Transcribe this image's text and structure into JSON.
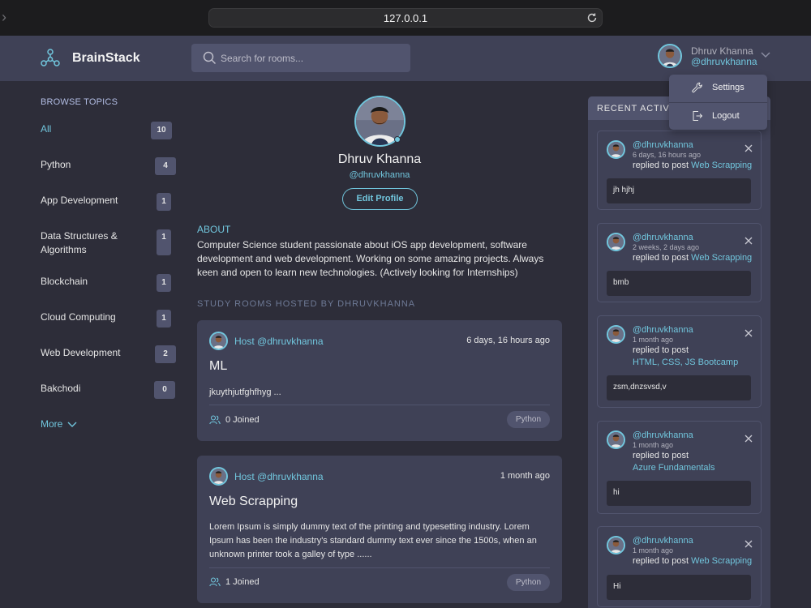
{
  "browser": {
    "url": "127.0.0.1"
  },
  "header": {
    "brand": "BrainStack",
    "search_placeholder": "Search for rooms...",
    "user_name": "Dhruv Khanna",
    "user_handle": "@dhruvkhanna"
  },
  "menu": {
    "settings": "Settings",
    "logout": "Logout"
  },
  "sidebar": {
    "title": "BROWSE TOPICS",
    "topics": [
      {
        "label": "All",
        "count": "10"
      },
      {
        "label": "Python",
        "count": "4"
      },
      {
        "label": "App Development",
        "count": "1"
      },
      {
        "label": "Data Structures & Algorithms",
        "count": "1"
      },
      {
        "label": "Blockchain",
        "count": "1"
      },
      {
        "label": "Cloud Computing",
        "count": "1"
      },
      {
        "label": "Web Development",
        "count": "2"
      },
      {
        "label": "Bakchodi",
        "count": "0"
      }
    ],
    "more": "More"
  },
  "profile": {
    "name": "Dhruv Khanna",
    "handle": "@dhruvkhanna",
    "edit_label": "Edit Profile",
    "about_title": "ABOUT",
    "about_text": "Computer Science student passionate about iOS app development, software development and web development. Working on some amazing projects. Always keen and open to learn new technologies. (Actively looking for Internships)",
    "rooms_title": "STUDY ROOMS HOSTED BY DHRUVKHANNA"
  },
  "rooms": [
    {
      "host": "Host @dhruvkhanna",
      "time": "6 days, 16 hours ago",
      "title": "ML",
      "description": "jkuythjutfghfhyg ...",
      "joined": "0 Joined",
      "topic": "Python"
    },
    {
      "host": "Host @dhruvkhanna",
      "time": "1 month ago",
      "title": "Web Scrapping",
      "description": "Lorem Ipsum is simply dummy text of the printing and typesetting industry. Lorem Ipsum has been the industry's standard dummy text ever since the 1500s, when an unknown printer took a galley of type ......",
      "joined": "1 Joined",
      "topic": "Python"
    }
  ],
  "recent": {
    "title": "RECENT ACTIVITIES",
    "items": [
      {
        "handle": "@dhruvkhanna",
        "time": "6 days, 16 hours ago",
        "action": "replied to post",
        "post": "Web Scrapping",
        "message": "jh hjhj"
      },
      {
        "handle": "@dhruvkhanna",
        "time": "2 weeks, 2 days ago",
        "action": "replied to post",
        "post": "Web Scrapping",
        "message": "bmb"
      },
      {
        "handle": "@dhruvkhanna",
        "time": "1 month ago",
        "action": "replied to post",
        "post": "HTML, CSS, JS Bootcamp",
        "message": "zsm,dnzsvsd,v"
      },
      {
        "handle": "@dhruvkhanna",
        "time": "1 month ago",
        "action": "replied to post",
        "post": "Azure Fundamentals",
        "message": "hi"
      },
      {
        "handle": "@dhruvkhanna",
        "time": "1 month ago",
        "action": "replied to post",
        "post": "Web Scrapping",
        "message": "Hi"
      }
    ]
  },
  "colors": {
    "accent": "#71c6dd",
    "background": "#2d2d39",
    "panel": "#3f4156"
  }
}
